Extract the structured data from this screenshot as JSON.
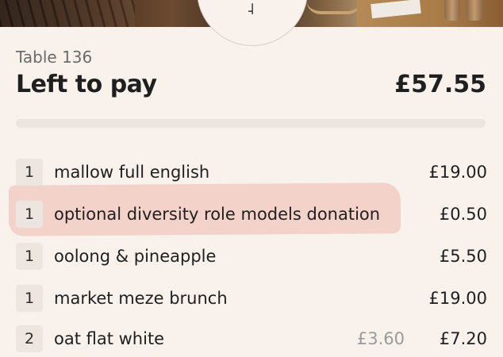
{
  "header": {
    "table_label": "Table 136",
    "title": "Left to pay",
    "amount": "£57.55",
    "paid_progress": 0
  },
  "items": [
    {
      "qty": "1",
      "name": "mallow full english",
      "price": "£19.00"
    },
    {
      "qty": "1",
      "name": "optional diversity role models donation",
      "price": "£0.50",
      "highlighted": true
    },
    {
      "qty": "1",
      "name": "oolong & pineapple",
      "price": "£5.50"
    },
    {
      "qty": "1",
      "name": "market meze brunch",
      "price": "£19.00"
    },
    {
      "qty": "2",
      "name": "oat flat white",
      "unit_price": "£3.60",
      "price": "£7.20"
    }
  ],
  "colors": {
    "background": "#f9f2ec",
    "highlight": "#ecaaa0",
    "qty_badge": "#ede6e0",
    "progress_track": "#ece5df"
  }
}
